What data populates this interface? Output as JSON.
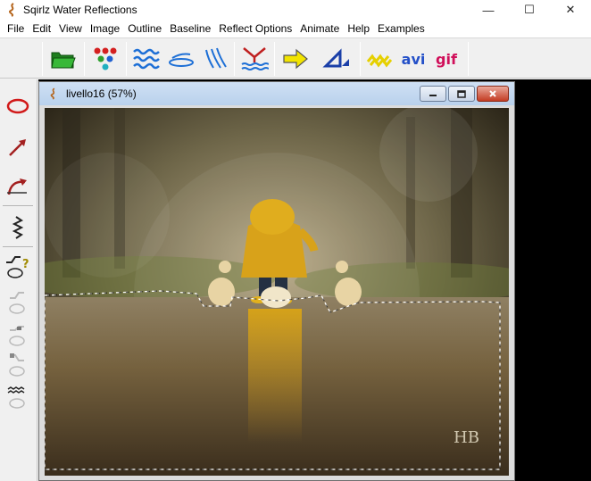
{
  "app": {
    "title": "Sqirlz Water Reflections"
  },
  "window_controls": {
    "minimize": "—",
    "maximize": "☐",
    "close": "✕"
  },
  "menu": [
    "File",
    "Edit",
    "View",
    "Image",
    "Outline",
    "Baseline",
    "Reflect Options",
    "Animate",
    "Help",
    "Examples"
  ],
  "toolbar": {
    "avi_label": "avi",
    "gif_label": "gif"
  },
  "child_window": {
    "title": "livello16  (57%)"
  },
  "photo": {
    "signature": "HB"
  },
  "colors": {
    "accent_red": "#d11a1a",
    "accent_blue": "#2060d0",
    "tb_yellow": "#f2e400",
    "selection": "#ffffff"
  }
}
